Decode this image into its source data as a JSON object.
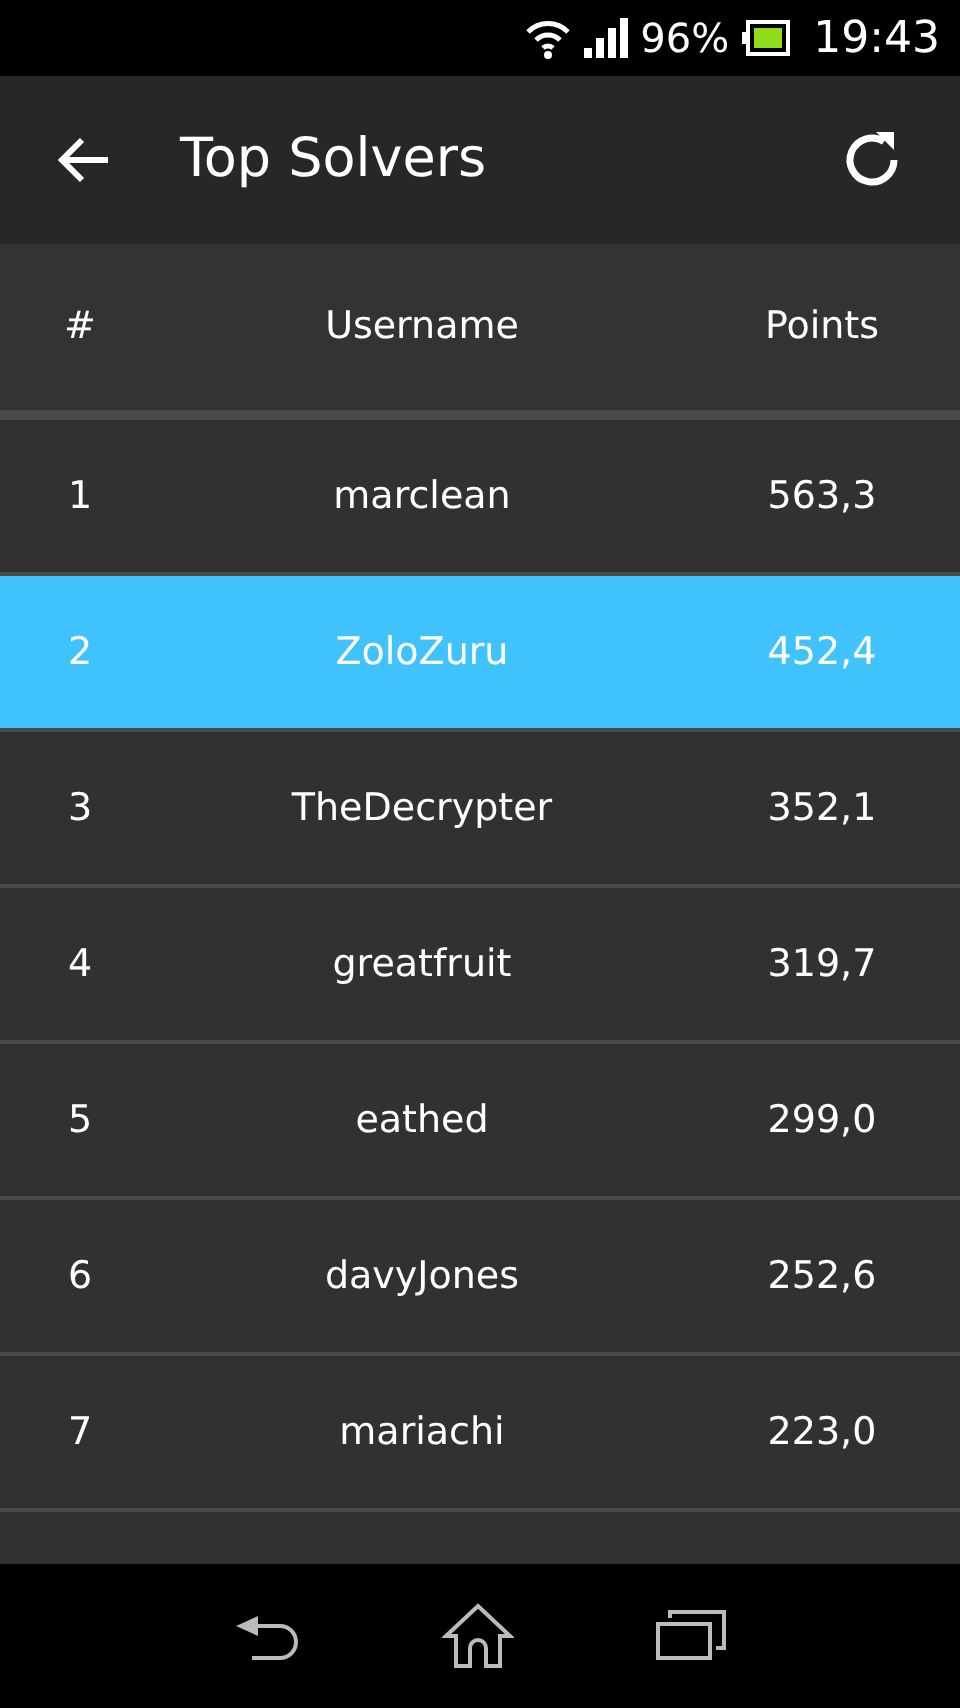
{
  "status_bar": {
    "battery": "96%",
    "time": "19:43"
  },
  "toolbar": {
    "title": "Top Solvers"
  },
  "table": {
    "columns": [
      "#",
      "Username",
      "Points"
    ],
    "rows": [
      {
        "rank": "1",
        "username": "marclean",
        "points": "563,3",
        "selected": false
      },
      {
        "rank": "2",
        "username": "ZoloZuru",
        "points": "452,4",
        "selected": true
      },
      {
        "rank": "3",
        "username": "TheDecrypter",
        "points": "352,1",
        "selected": false
      },
      {
        "rank": "4",
        "username": "greatfruit",
        "points": "319,7",
        "selected": false
      },
      {
        "rank": "5",
        "username": "eathed",
        "points": "299,0",
        "selected": false
      },
      {
        "rank": "6",
        "username": "davyJones",
        "points": "252,6",
        "selected": false
      },
      {
        "rank": "7",
        "username": "mariachi",
        "points": "223,0",
        "selected": false
      }
    ]
  }
}
